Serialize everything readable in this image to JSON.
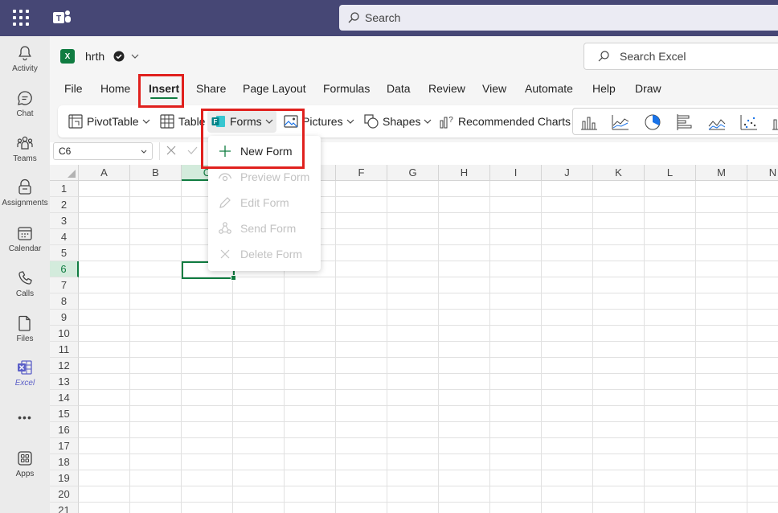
{
  "topbar": {
    "search_placeholder": "Search"
  },
  "rail": {
    "items": [
      {
        "label": "Activity",
        "icon": "bell-icon"
      },
      {
        "label": "Chat",
        "icon": "chat-icon"
      },
      {
        "label": "Teams",
        "icon": "teams-icon"
      },
      {
        "label": "Assignments",
        "icon": "assignments-icon"
      },
      {
        "label": "Calendar",
        "icon": "calendar-icon"
      },
      {
        "label": "Calls",
        "icon": "phone-icon"
      },
      {
        "label": "Files",
        "icon": "file-icon"
      },
      {
        "label": "Excel",
        "icon": "excel-icon"
      },
      {
        "label": "",
        "icon": "more-icon"
      },
      {
        "label": "Apps",
        "icon": "apps-icon"
      }
    ],
    "more": "•••"
  },
  "document": {
    "name": "hrth",
    "logo_letter": "X"
  },
  "search_excel": {
    "placeholder": "Search Excel"
  },
  "tabs": [
    "File",
    "Home",
    "Insert",
    "Share",
    "Page Layout",
    "Formulas",
    "Data",
    "Review",
    "View",
    "Automate",
    "Help",
    "Draw"
  ],
  "active_tab": "Insert",
  "ribbon": {
    "pivot": "PivotTable",
    "table": "Table",
    "forms": "Forms",
    "pictures": "Pictures",
    "shapes": "Shapes",
    "recommended_charts": "Recommended Charts"
  },
  "formula_bar": {
    "name_box": "C6"
  },
  "grid": {
    "columns": [
      "A",
      "B",
      "C",
      "D",
      "E",
      "F",
      "G",
      "H",
      "I",
      "J",
      "K",
      "L",
      "M",
      "N"
    ],
    "rows": [
      "1",
      "2",
      "3",
      "4",
      "5",
      "6",
      "7",
      "8",
      "9",
      "10",
      "11",
      "12",
      "13",
      "14",
      "15",
      "16",
      "17",
      "18",
      "19",
      "20",
      "21"
    ],
    "selected_col": "C",
    "selected_row": "6"
  },
  "forms_menu": {
    "new_form": "New Form",
    "preview_form": "Preview Form",
    "edit_form": "Edit Form",
    "send_form": "Send Form",
    "delete_form": "Delete Form"
  },
  "colors": {
    "teams_bar": "#464775",
    "excel_green": "#107c41",
    "highlight_red": "#e0201d",
    "teams_accent": "#5b5fc7"
  }
}
